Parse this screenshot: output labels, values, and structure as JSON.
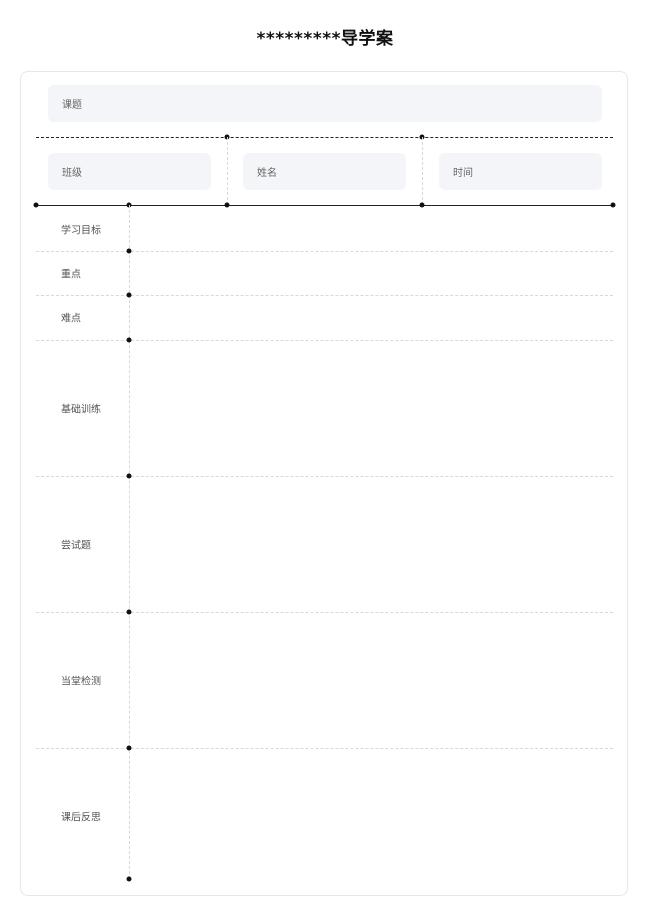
{
  "document": {
    "title": "*********导学案"
  },
  "header_fields": {
    "topic_label": "课题",
    "class_label": "班级",
    "name_label": "姓名",
    "time_label": "时间"
  },
  "sections": [
    {
      "label": "学习目标"
    },
    {
      "label": "重点"
    },
    {
      "label": "难点"
    },
    {
      "label": "基础训练"
    },
    {
      "label": "尝试题"
    },
    {
      "label": "当堂检测"
    },
    {
      "label": "课后反思"
    }
  ]
}
